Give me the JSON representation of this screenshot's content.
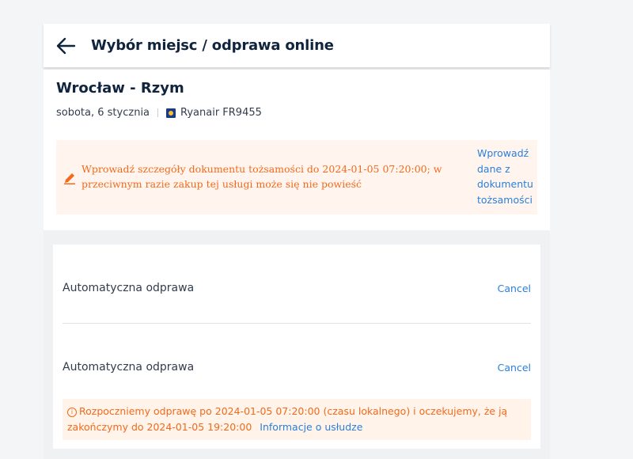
{
  "header": {
    "title": "Wybór miejsc / odprawa online"
  },
  "flight": {
    "route": "Wrocław - Rzym",
    "date": "sobota, 6 stycznia",
    "airline_flight": "Ryanair FR9455"
  },
  "document_warning": {
    "text": "Wprowadź szczegóły dokumentu tożsamości do 2024-01-05 07:20:00; w przeciwnym razie zakup tej usługi może się nie powieść",
    "link_label": "Wprowadź dane z dokumentu tożsamości"
  },
  "checkin": {
    "items": [
      {
        "label": "Automatyczna odprawa",
        "cancel_label": "Cancel"
      },
      {
        "label": "Automatyczna odprawa",
        "cancel_label": "Cancel"
      }
    ],
    "info_text": "Rozpoczniemy odprawę po 2024-01-05 07:20:00 (czasu lokalnego) i oczekujemy, że ją zakończymy do 2024-01-05 19:20:00",
    "info_link": "Informacje o usłudze"
  },
  "icons": {
    "back": "arrow-left-icon",
    "edit": "pencil-icon",
    "info": "info-circle-icon",
    "airline": "ryanair-logo"
  },
  "colors": {
    "accent_link": "#2a7fdc",
    "warning": "#f26a1b",
    "warning_bg": "#fff5ee",
    "heading": "#10243e"
  }
}
